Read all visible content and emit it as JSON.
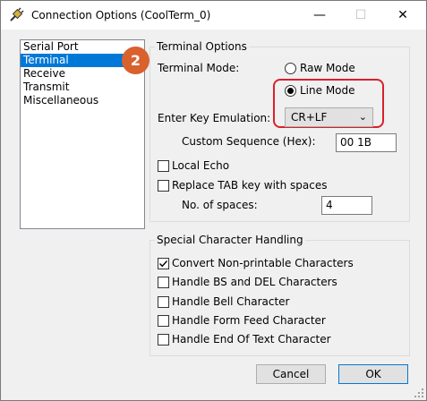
{
  "window": {
    "title": "Connection Options (CoolTerm_0)",
    "minimize_glyph": "—",
    "maximize_glyph": "☐",
    "close_glyph": "✕"
  },
  "sidebar": {
    "items": [
      {
        "label": "Serial Port",
        "selected": false
      },
      {
        "label": "Terminal",
        "selected": true
      },
      {
        "label": "Receive",
        "selected": false
      },
      {
        "label": "Transmit",
        "selected": false
      },
      {
        "label": "Miscellaneous",
        "selected": false
      }
    ]
  },
  "callout_badge": "2",
  "terminal_options": {
    "group_label": "Terminal Options",
    "terminal_mode_label": "Terminal Mode:",
    "raw_mode_label": "Raw Mode",
    "line_mode_label": "Line Mode",
    "selected_mode": "Line Mode",
    "enter_key_label": "Enter Key Emulation:",
    "enter_key_value": "CR+LF",
    "custom_sequence_label": "Custom Sequence (Hex):",
    "custom_sequence_value": "00 1B",
    "local_echo_label": "Local Echo",
    "local_echo_checked": false,
    "replace_tab_label": "Replace TAB key with spaces",
    "replace_tab_checked": false,
    "num_spaces_label": "No. of spaces:",
    "num_spaces_value": "4"
  },
  "special_chars": {
    "group_label": "Special Character Handling",
    "items": [
      {
        "label": "Convert Non-printable Characters",
        "checked": true
      },
      {
        "label": "Handle BS and DEL Characters",
        "checked": false
      },
      {
        "label": "Handle Bell Character",
        "checked": false
      },
      {
        "label": "Handle Form Feed Character",
        "checked": false
      },
      {
        "label": "Handle End Of Text Character",
        "checked": false
      }
    ]
  },
  "buttons": {
    "cancel": "Cancel",
    "ok": "OK"
  },
  "colors": {
    "selection": "#0078d7",
    "badge": "#d9612e",
    "highlight": "#d9212c"
  },
  "icons": {
    "app": "coolterm-plug-icon",
    "dropdown": "chevron-down-icon",
    "check": "checkmark-icon"
  }
}
